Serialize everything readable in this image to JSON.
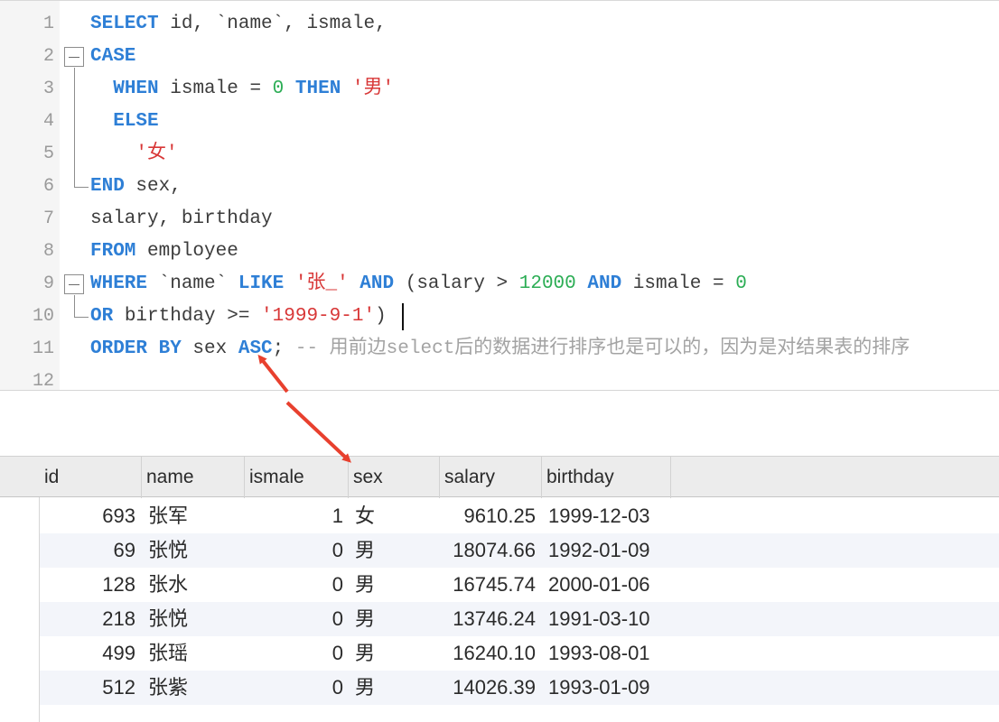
{
  "editor": {
    "line_numbers": [
      "1",
      "2",
      "3",
      "4",
      "5",
      "6",
      "7",
      "8",
      "9",
      "10",
      "11",
      "12"
    ],
    "lines": [
      [
        {
          "t": "SELECT",
          "c": "kw"
        },
        {
          "t": " id, `name`, ismale,",
          "c": ""
        }
      ],
      [
        {
          "t": "CASE",
          "c": "kw"
        }
      ],
      [
        {
          "t": "  ",
          "c": ""
        },
        {
          "t": "WHEN",
          "c": "kw"
        },
        {
          "t": " ismale = ",
          "c": ""
        },
        {
          "t": "0",
          "c": "num"
        },
        {
          "t": " ",
          "c": ""
        },
        {
          "t": "THEN",
          "c": "kw"
        },
        {
          "t": " ",
          "c": ""
        },
        {
          "t": "'男'",
          "c": "str"
        }
      ],
      [
        {
          "t": "  ",
          "c": ""
        },
        {
          "t": "ELSE",
          "c": "kw"
        }
      ],
      [
        {
          "t": "    ",
          "c": ""
        },
        {
          "t": "'女'",
          "c": "str"
        }
      ],
      [
        {
          "t": "END",
          "c": "kw"
        },
        {
          "t": " sex,",
          "c": ""
        }
      ],
      [
        {
          "t": "salary, birthday",
          "c": ""
        }
      ],
      [
        {
          "t": "FROM",
          "c": "kw"
        },
        {
          "t": " employee",
          "c": ""
        }
      ],
      [
        {
          "t": "WHERE",
          "c": "kw"
        },
        {
          "t": " `name` ",
          "c": ""
        },
        {
          "t": "LIKE",
          "c": "kw"
        },
        {
          "t": " ",
          "c": ""
        },
        {
          "t": "'张_'",
          "c": "str"
        },
        {
          "t": " ",
          "c": ""
        },
        {
          "t": "AND",
          "c": "kw"
        },
        {
          "t": " (salary > ",
          "c": ""
        },
        {
          "t": "12000",
          "c": "num"
        },
        {
          "t": " ",
          "c": ""
        },
        {
          "t": "AND",
          "c": "kw"
        },
        {
          "t": " ismale = ",
          "c": ""
        },
        {
          "t": "0",
          "c": "num"
        }
      ],
      [
        {
          "t": "OR",
          "c": "kw"
        },
        {
          "t": " birthday >= ",
          "c": ""
        },
        {
          "t": "'1999-9-1'",
          "c": "str"
        },
        {
          "t": ")",
          "c": ""
        }
      ],
      [
        {
          "t": "ORDER BY",
          "c": "kw"
        },
        {
          "t": " sex ",
          "c": ""
        },
        {
          "t": "ASC",
          "c": "kw"
        },
        {
          "t": "; ",
          "c": ""
        },
        {
          "t": "-- 用前边select后的数据进行排序也是可以的，因为是对结果表的排序",
          "c": "cmt"
        }
      ],
      []
    ]
  },
  "results": {
    "columns": [
      "id",
      "name",
      "ismale",
      "sex",
      "salary",
      "birthday"
    ],
    "rows": [
      [
        "693",
        "张军",
        "1",
        "女",
        "9610.25",
        "1999-12-03"
      ],
      [
        "69",
        "张悦",
        "0",
        "男",
        "18074.66",
        "1992-01-09"
      ],
      [
        "128",
        "张水",
        "0",
        "男",
        "16745.74",
        "2000-01-06"
      ],
      [
        "218",
        "张悦",
        "0",
        "男",
        "13746.24",
        "1991-03-10"
      ],
      [
        "499",
        "张瑶",
        "0",
        "男",
        "16240.10",
        "1993-08-01"
      ],
      [
        "512",
        "张紫",
        "0",
        "男",
        "14026.39",
        "1993-01-09"
      ]
    ]
  },
  "colors": {
    "keyword": "#2e7fd6",
    "string": "#d83737",
    "number": "#2cad55",
    "comment": "#a3a3a3",
    "annotation_arrow": "#e8402e"
  }
}
